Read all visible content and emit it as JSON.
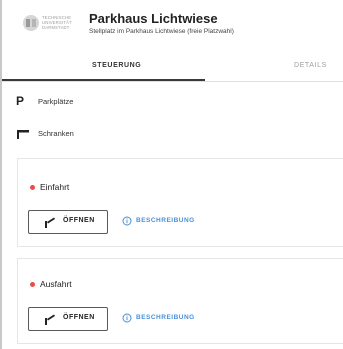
{
  "header": {
    "logo_text": [
      "TECHNISCHE",
      "UNIVERSITÄT",
      "DARMSTADT"
    ],
    "title": "Parkhaus Lichtwiese",
    "subtitle": "Stellplatz im Parkhaus Lichtwiese (freie Platzwahl)"
  },
  "tabs": [
    {
      "label": "STEUERUNG",
      "active": true
    },
    {
      "label": "DETAILS",
      "active": false
    }
  ],
  "items": [
    {
      "label": "Parkplätze",
      "icon": "parking-icon"
    },
    {
      "label": "Schranken",
      "icon": "barrier-icon"
    }
  ],
  "gates": [
    {
      "title": "Einfahrt",
      "status_color": "#e84c4c",
      "open_label": "ÖFFNEN",
      "description_label": "BESCHREIBUNG"
    },
    {
      "title": "Ausfahrt",
      "status_color": "#e84c4c",
      "open_label": "ÖFFNEN",
      "description_label": "BESCHREIBUNG"
    }
  ],
  "colors": {
    "accent": "#4a8fd6",
    "status": "#e84c4c"
  }
}
